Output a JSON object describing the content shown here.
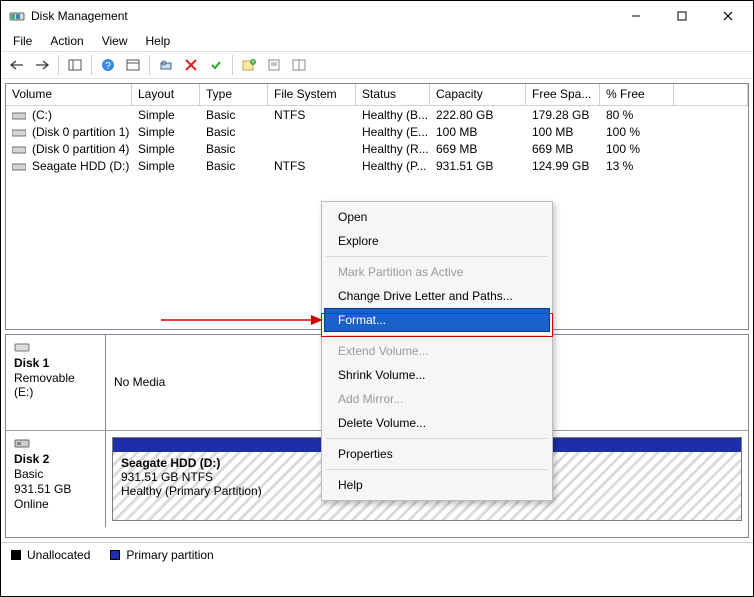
{
  "window": {
    "title": "Disk Management"
  },
  "menu": {
    "file": "File",
    "action": "Action",
    "view": "View",
    "help": "Help"
  },
  "columns": {
    "volume": "Volume",
    "layout": "Layout",
    "type": "Type",
    "fs": "File System",
    "status": "Status",
    "capacity": "Capacity",
    "free": "Free Spa...",
    "pct": "% Free"
  },
  "volumes": [
    {
      "name": "(C:)",
      "layout": "Simple",
      "type": "Basic",
      "fs": "NTFS",
      "status": "Healthy (B...",
      "capacity": "222.80 GB",
      "free": "179.28 GB",
      "pct": "80 %"
    },
    {
      "name": "(Disk 0 partition 1)",
      "layout": "Simple",
      "type": "Basic",
      "fs": "",
      "status": "Healthy (E...",
      "capacity": "100 MB",
      "free": "100 MB",
      "pct": "100 %"
    },
    {
      "name": "(Disk 0 partition 4)",
      "layout": "Simple",
      "type": "Basic",
      "fs": "",
      "status": "Healthy (R...",
      "capacity": "669 MB",
      "free": "669 MB",
      "pct": "100 %"
    },
    {
      "name": "Seagate HDD (D:)",
      "layout": "Simple",
      "type": "Basic",
      "fs": "NTFS",
      "status": "Healthy (P...",
      "capacity": "931.51 GB",
      "free": "124.99 GB",
      "pct": "13 %"
    }
  ],
  "disks": {
    "d1": {
      "title": "Disk 1",
      "line1": "Removable (E:)",
      "line2": "No Media"
    },
    "d2": {
      "title": "Disk 2",
      "line1": "Basic",
      "line2": "931.51 GB",
      "line3": "Online",
      "part_name": "Seagate HDD  (D:)",
      "part_l2": "931.51 GB NTFS",
      "part_l3": "Healthy (Primary Partition)"
    }
  },
  "legend": {
    "unalloc": "Unallocated",
    "primary": "Primary partition"
  },
  "ctx": {
    "open": "Open",
    "explore": "Explore",
    "mark": "Mark Partition as Active",
    "change": "Change Drive Letter and Paths...",
    "format": "Format...",
    "extend": "Extend Volume...",
    "shrink": "Shrink Volume...",
    "mirror": "Add Mirror...",
    "delete": "Delete Volume...",
    "props": "Properties",
    "help": "Help"
  },
  "colors": {
    "accent": "#1e2ea8",
    "highlight": "#1a62c9",
    "annotation": "#d40000"
  }
}
